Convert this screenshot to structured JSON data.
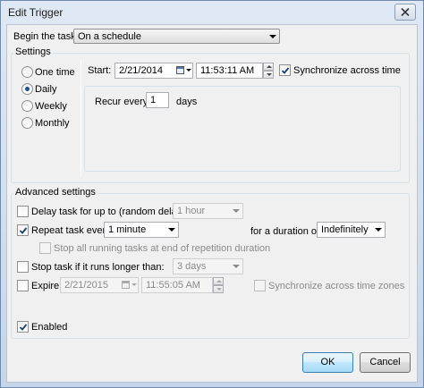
{
  "window": {
    "title": "Edit Trigger"
  },
  "begin": {
    "label": "Begin the task:",
    "value": "On a schedule"
  },
  "settings": {
    "group_label": "Settings",
    "radios": [
      {
        "label": "One time",
        "selected": false
      },
      {
        "label": "Daily",
        "selected": true
      },
      {
        "label": "Weekly",
        "selected": false
      },
      {
        "label": "Monthly",
        "selected": false
      }
    ],
    "start_label": "Start:",
    "start_date": "2/21/2014",
    "start_time": "11:53:11 AM",
    "sync_label": "Synchronize across time",
    "sync_checked": true,
    "recur_label": "Recur every:",
    "recur_value": "1",
    "recur_unit": "days"
  },
  "advanced": {
    "group_label": "Advanced settings",
    "delay": {
      "label": "Delay task for up to (random delay):",
      "checked": false,
      "value": "1 hour"
    },
    "repeat": {
      "label": "Repeat task every:",
      "checked": true,
      "value": "1 minute",
      "duration_label": "for a duration of:",
      "duration_value": "Indefinitely"
    },
    "stop_running": {
      "label": "Stop all running tasks at end of repetition duration",
      "checked": false
    },
    "stop_longer": {
      "label": "Stop task if it runs longer than:",
      "checked": false,
      "value": "3 days"
    },
    "expire": {
      "label": "Expire:",
      "checked": false,
      "date": "2/21/2015",
      "time": "11:55:05 AM",
      "sync_label": "Synchronize across time zones"
    },
    "enabled": {
      "label": "Enabled",
      "checked": true
    }
  },
  "buttons": {
    "ok": "OK",
    "cancel": "Cancel"
  }
}
